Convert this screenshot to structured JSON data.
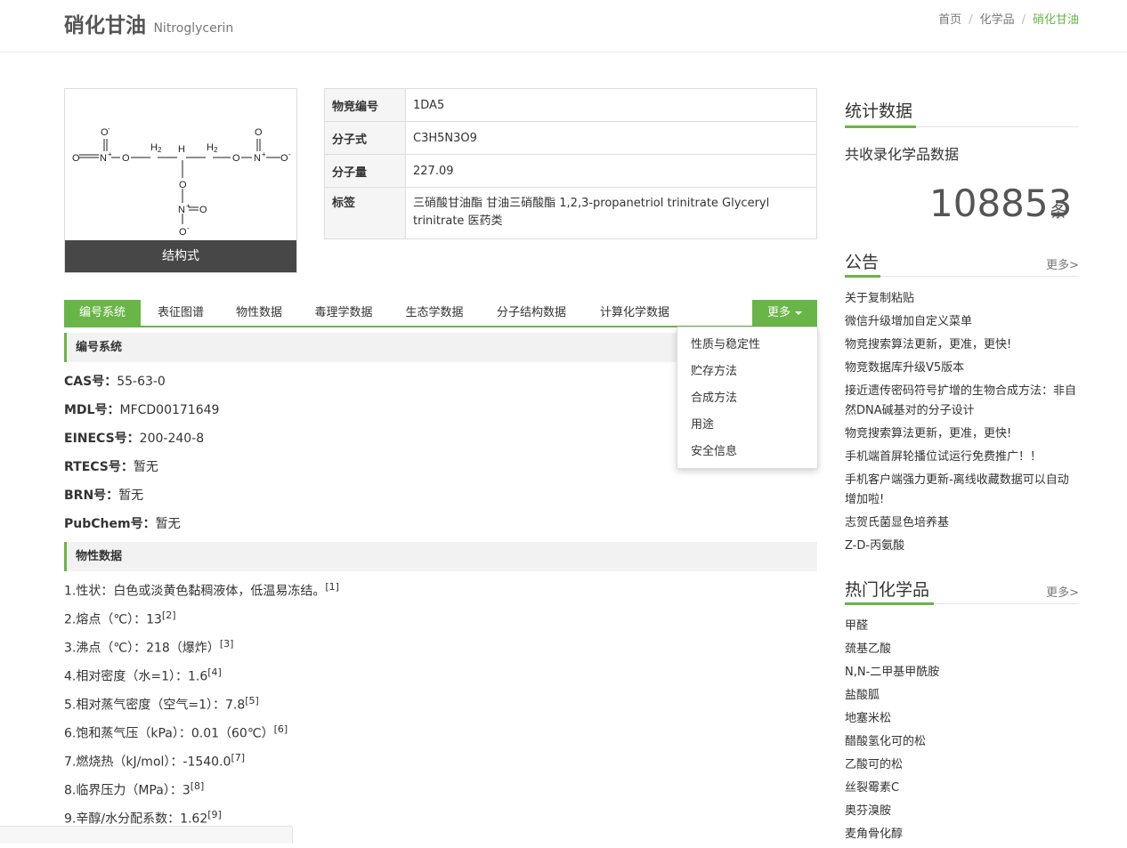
{
  "header": {
    "title_cn": "硝化甘油",
    "title_en": "Nitroglycerin",
    "breadcrumb": [
      "首页",
      "化学品",
      "硝化甘油"
    ]
  },
  "structure": {
    "caption": "结构式"
  },
  "info_table": [
    {
      "key": "物竞编号",
      "value": "1DA5"
    },
    {
      "key": "分子式",
      "value": "C3H5N3O9"
    },
    {
      "key": "分子量",
      "value": "227.09"
    },
    {
      "key": "标签",
      "value": "三硝酸甘油酯 甘油三硝酸酯 1,2,3-propanetriol trinitrate Glyceryl trinitrate 医药类"
    }
  ],
  "tabs": [
    "编号系统",
    "表征图谱",
    "物性数据",
    "毒理学数据",
    "生态学数据",
    "分子结构数据",
    "计算化学数据"
  ],
  "more_label": "更多",
  "more_menu": [
    "性质与稳定性",
    "贮存方法",
    "合成方法",
    "用途",
    "安全信息"
  ],
  "section_ids": {
    "title": "编号系统",
    "items": [
      {
        "key": "CAS号：",
        "value": "55-63-0"
      },
      {
        "key": "MDL号：",
        "value": "MFCD00171649"
      },
      {
        "key": "EINECS号：",
        "value": "200-240-8"
      },
      {
        "key": "RTECS号：",
        "value": "暂无"
      },
      {
        "key": "BRN号：",
        "value": "暂无"
      },
      {
        "key": "PubChem号：",
        "value": "暂无"
      }
    ]
  },
  "section_props": {
    "title": "物性数据",
    "items": [
      {
        "text": "1.性状：白色或淡黄色黏稠液体，低温易冻结。",
        "ref": "[1]"
      },
      {
        "text": "2.熔点（℃）：13",
        "ref": "[2]"
      },
      {
        "text": "3.沸点（℃）：218（爆炸）",
        "ref": "[3]"
      },
      {
        "text": "4.相对密度（水=1）：1.6",
        "ref": "[4]"
      },
      {
        "text": "5.相对蒸气密度（空气=1）：7.8",
        "ref": "[5]"
      },
      {
        "text": "6.饱和蒸气压（kPa）：0.01（60℃）",
        "ref": "[6]"
      },
      {
        "text": "7.燃烧热（kJ/mol）：-1540.0",
        "ref": "[7]"
      },
      {
        "text": "8.临界压力（MPa）：3",
        "ref": "[8]"
      },
      {
        "text": "9.辛醇/水分配系数：1.62",
        "ref": "[9]"
      }
    ]
  },
  "sidebar": {
    "stats": {
      "title": "统计数据",
      "subtitle": "共收录化学品数据",
      "count": "108853",
      "unit": "条"
    },
    "notices": {
      "title": "公告",
      "more": "更多>",
      "items": [
        "关于复制粘贴",
        "微信升级增加自定义菜单",
        "物竞搜索算法更新，更准，更快!",
        "物竞数据库升级V5版本",
        "接近遗传密码符号扩增的生物合成方法：非自然DNA碱基对的分子设计",
        "物竞搜索算法更新，更准，更快!",
        "手机端首屏轮播位试运行免费推广！！",
        "手机客户端强力更新-离线收藏数据可以自动增加啦!",
        "志贺氏菌显色培养基",
        "Z-D-丙氨酸"
      ]
    },
    "hot": {
      "title": "热门化学品",
      "more": "更多>",
      "items": [
        "甲醛",
        "巯基乙酸",
        "N,N-二甲基甲酰胺",
        "盐酸胍",
        "地塞米松",
        "醋酸氢化可的松",
        "乙酸可的松",
        "丝裂霉素C",
        "奥芬溴胺",
        "麦角骨化醇"
      ]
    }
  },
  "structure_atoms": [
    "O",
    "N",
    "O",
    "O",
    "H",
    "H",
    "H",
    "O",
    "O",
    "N",
    "O",
    "O",
    "N",
    "O",
    "O",
    "2",
    "2",
    "+",
    "+",
    "+",
    "-",
    "-",
    "-"
  ]
}
